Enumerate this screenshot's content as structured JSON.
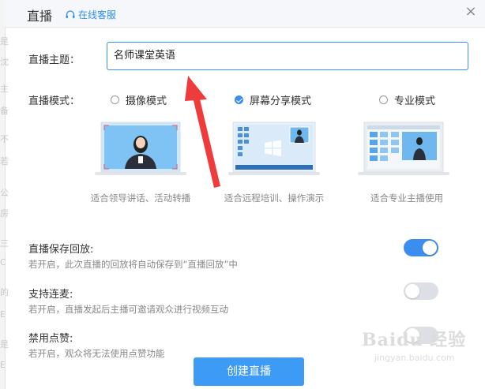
{
  "header": {
    "title": "直播",
    "service_label": "在线客服",
    "close": "×"
  },
  "topic": {
    "label": "直播主题：",
    "value": "名师课堂英语"
  },
  "mode": {
    "label": "直播模式：",
    "options": [
      {
        "label": "摄像模式",
        "desc": "适合领导讲话、活动转播",
        "selected": false
      },
      {
        "label": "屏幕分享模式",
        "desc": "适合远程培训、操作演示",
        "selected": true
      },
      {
        "label": "专业模式",
        "desc": "适合专业主播使用",
        "selected": false
      }
    ]
  },
  "settings": [
    {
      "title": "直播保存回放:",
      "desc": "若开启，此次直播的回放将自动保存到“直播回放”中",
      "enabled": true
    },
    {
      "title": "支持连麦:",
      "desc": "若开启，直播发起后主播可邀请观众进行视频互动",
      "enabled": false
    },
    {
      "title": "禁用点赞:",
      "desc": "若开启，观众将无法使用点赞功能",
      "enabled": false
    }
  ],
  "create_button": "创建直播",
  "colors": {
    "accent": "#3b8ef0",
    "arrow": "#ee3b3b"
  },
  "watermark": {
    "main": "Baidu 经验",
    "sub": "jingyan.baidu.com"
  }
}
